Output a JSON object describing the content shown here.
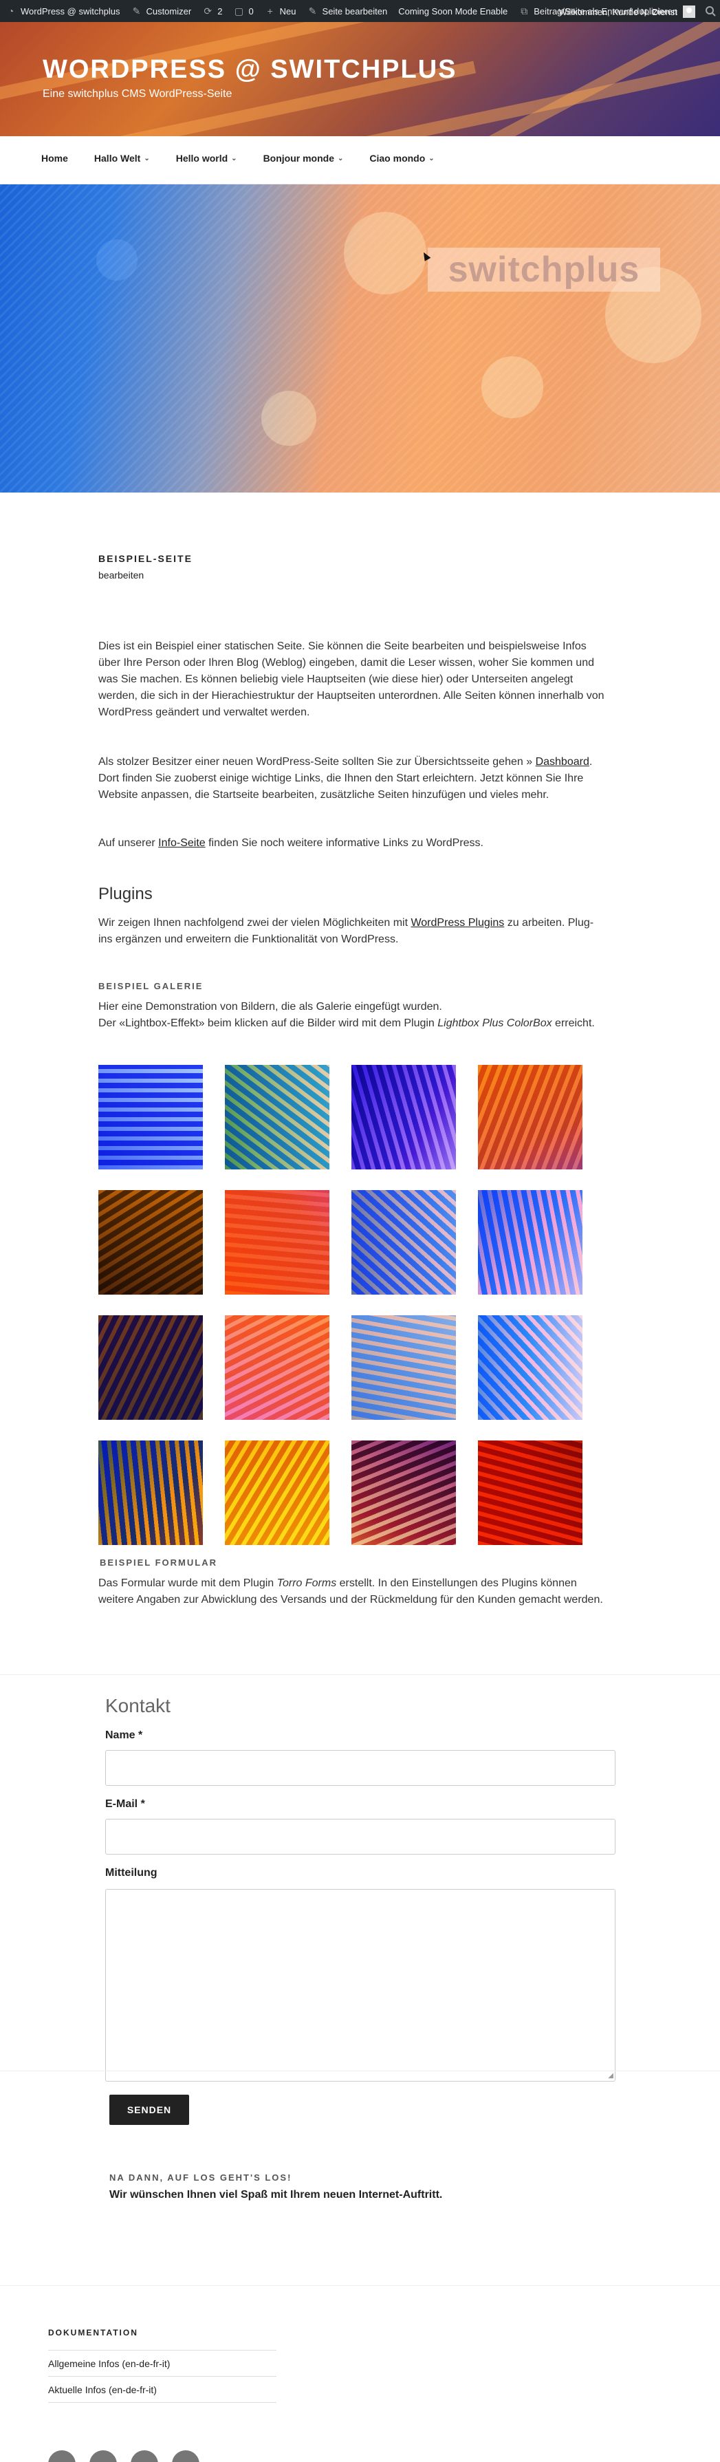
{
  "adminbar": {
    "site": "WordPress @ switchplus",
    "customizer": "Customizer",
    "updates": "2",
    "comments": "0",
    "new": "Neu",
    "edit_page": "Seite bearbeiten",
    "coming_soon": "Coming Soon Mode Enable",
    "duplicate": "Beitrag/Seite als Entwurf duplizieren",
    "greeting": "Willkommen, Kunde N. Dienst"
  },
  "header": {
    "title": "WORDPRESS @ SWITCHPLUS",
    "description": "Eine switchplus CMS WordPress-Seite"
  },
  "nav": {
    "items": [
      "Home",
      "Hallo Welt",
      "Hello world",
      "Bonjour monde",
      "Ciao mondo"
    ]
  },
  "hero": {
    "logo_text": "switchplus"
  },
  "page": {
    "title": "BEISPIEL-SEITE",
    "edit": "bearbeiten",
    "p1": "Dies ist ein Beispiel einer statischen Seite. Sie können die Seite bearbeiten und beispielsweise Infos über Ihre Person oder Ihren Blog (Weblog) eingeben, damit die Leser wissen, woher Sie kommen und was Sie machen. Es können beliebig viele Hauptseiten (wie diese hier) oder Unterseiten angelegt werden, die sich in der Hierachiestruktur der Hauptseiten unterordnen. Alle Seiten können innerhalb von WordPress geändert und verwaltet werden.",
    "p2_before": "Als stolzer Besitzer einer neuen WordPress-Seite sollten Sie zur Übersichtsseite gehen »",
    "p2_link": "Dashboard",
    "p2_after": ". Dort finden Sie zuoberst einige wichtige Links, die Ihnen den Start erleichtern. Jetzt können Sie Ihre Website anpassen, die Startseite bearbeiten, zusätzliche Seiten hinzufügen und vieles mehr.",
    "p3_before": "Auf unserer",
    "p3_link": "Info-Seite",
    "p3_after": "finden Sie noch weitere informative Links zu WordPress.",
    "plugins_heading": "Plugins",
    "p4_before": "Wir zeigen Ihnen nachfolgend zwei der vielen Möglichkeiten mit",
    "p4_link": "WordPress Plugins",
    "p4_after": "zu arbeiten. Plug-ins ergänzen und erweitern die Funktionalität von WordPress.",
    "gallery_heading": "BEISPIEL GALERIE",
    "p5_line1": "Hier eine Demonstration von Bildern, die als Galerie eingefügt wurden.",
    "p5_line2_before": "Der «Lightbox-Effekt» beim klicken auf die Bilder wird mit dem Plugin",
    "p5_line2_em": "Lightbox Plus ColorBox",
    "p5_line2_after": "erreicht.",
    "form_heading": "BEISPIEL FORMULAR",
    "p6_before": "Das Formular wurde mit dem Plugin",
    "p6_em": "Torro Forms",
    "p6_after": "erstellt. In den Einstellungen des Plugins können weitere Angaben zur Abwicklung des Versands und der Rückmeldung für den Kunden gemacht werden."
  },
  "gallery": {
    "colors": [
      [
        "#2a3fc0",
        "#c8d0f0",
        "#6a7ae0"
      ],
      [
        "#2a6a8a",
        "#e0b040",
        "#8ab0c8"
      ],
      [
        "#2a1a8a",
        "#8a6ae0",
        "#c0b0f0"
      ],
      [
        "#c06020",
        "#f0b040",
        "#6a4ab0"
      ],
      [
        "#6a4a10",
        "#f0b030",
        "#2a1a1a"
      ],
      [
        "#e05a20",
        "#f08040",
        "#7a5aa0"
      ],
      [
        "#3a5ac0",
        "#e0a040",
        "#90a8e0"
      ],
      [
        "#2a5ae0",
        "#f09060",
        "#d0c0e0"
      ],
      [
        "#402a5a",
        "#e0a030",
        "#2a2a6a"
      ],
      [
        "#e06a3a",
        "#f0b0a0",
        "#a05aa0"
      ],
      [
        "#5a7ac0",
        "#e0a040",
        "#a0b0d0"
      ],
      [
        "#2a6ae0",
        "#f0a080",
        "#e0d0e0"
      ],
      [
        "#1a3aa0",
        "#f0b020",
        "#c08020"
      ],
      [
        "#c07010",
        "#f8d060",
        "#e0a020"
      ],
      [
        "#4a1a4a",
        "#c0a0d0",
        "#e0a050"
      ],
      [
        "#a02010",
        "#f0a010",
        "#6a1a30"
      ]
    ]
  },
  "form": {
    "title": "Kontakt",
    "name_label": "Name *",
    "email_label": "E-Mail *",
    "message_label": "Mitteilung",
    "submit": "SENDEN",
    "cta_heading": "NA DANN, AUF LOS GEHT'S LOS!",
    "cta_text": "Wir wünschen Ihnen viel Spaß mit Ihrem neuen Internet-Auftritt."
  },
  "footer": {
    "heading": "DOKUMENTATION",
    "links": [
      "Allgemeine Infos (en-de-fr-it)",
      "Aktuelle Infos (en-de-fr-it)"
    ]
  }
}
